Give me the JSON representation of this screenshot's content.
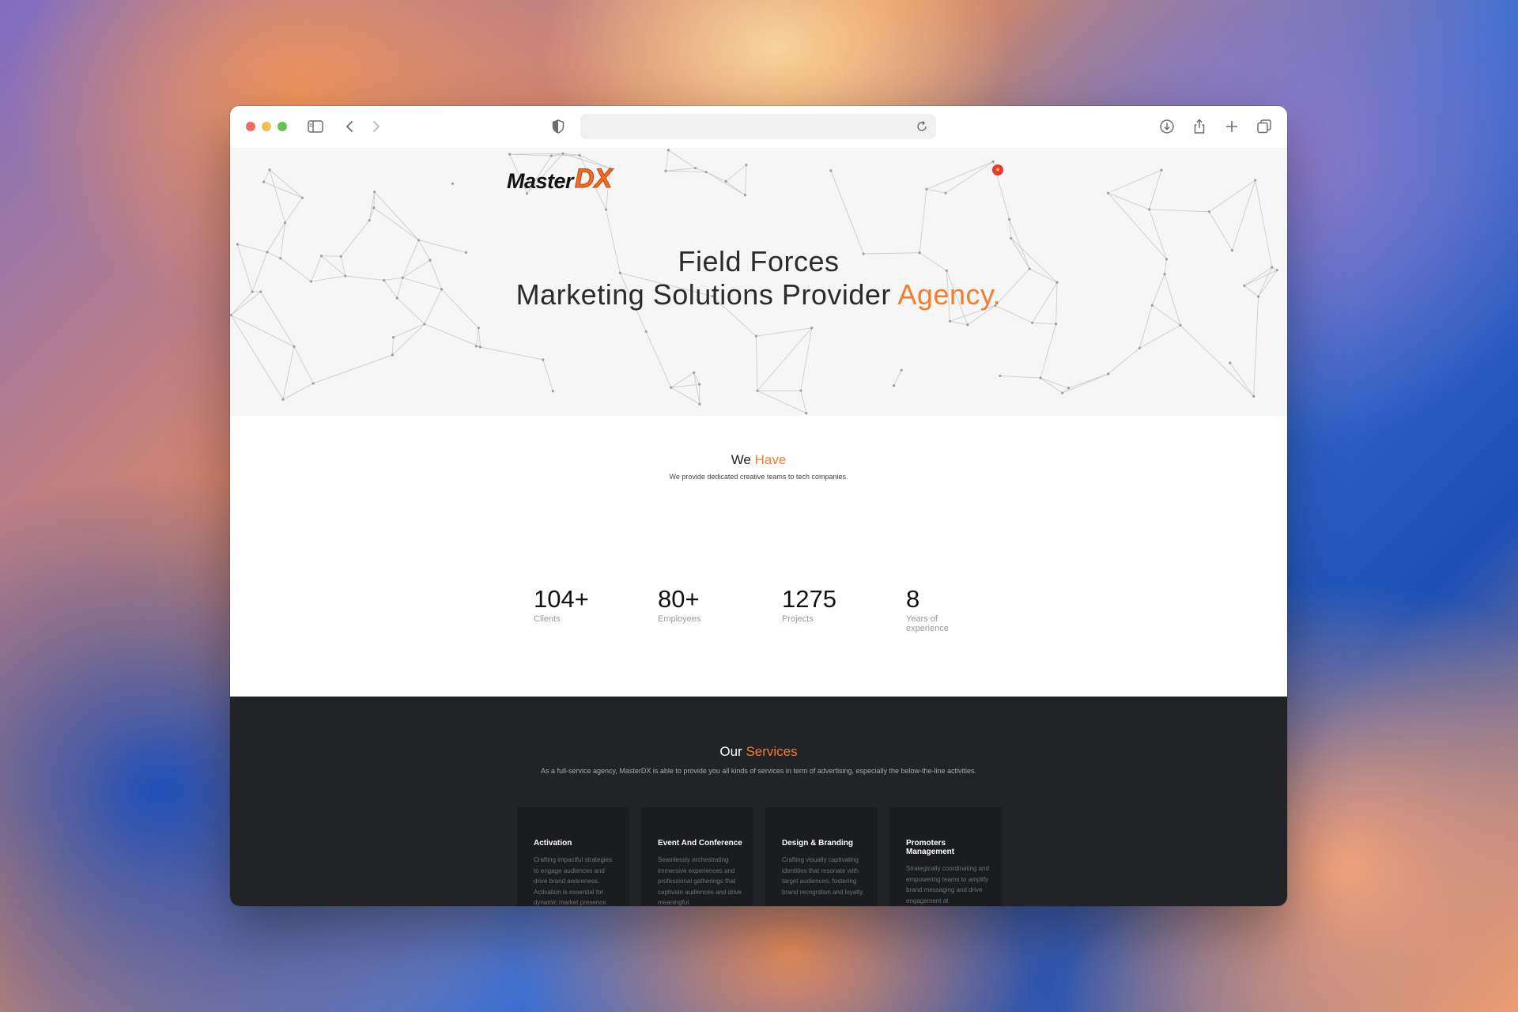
{
  "browser": {
    "url": "",
    "icons": [
      "sidebar-icon",
      "back-icon",
      "forward-icon",
      "privacy-shield-icon",
      "reload-icon",
      "download-icon",
      "share-icon",
      "new-tab-icon",
      "tabs-overview-icon"
    ]
  },
  "colors": {
    "accent": "#f47c2a",
    "dark_section": "#222327",
    "hero_bg": "#f6f6f6"
  },
  "hero": {
    "logo_master": "Master",
    "logo_dx": "DX",
    "title_line1": "Field Forces",
    "title_line2": "Marketing Solutions Provider ",
    "title_accent": "Agency.",
    "badge_icon": "vietnam-flag-icon"
  },
  "have": {
    "title_plain": "We ",
    "title_accent": "Have",
    "subtitle": "We provide dedicated creative teams to tech companies.",
    "stats": [
      {
        "value": "104+",
        "label": "Clients"
      },
      {
        "value": "80+",
        "label": "Employees"
      },
      {
        "value": "1275",
        "label": "Projects"
      },
      {
        "value": "8",
        "label": "Years of experience"
      }
    ]
  },
  "services": {
    "title_plain": "Our ",
    "title_accent": "Services",
    "subtitle": "As a full-service agency, MasterDX is able to provide you all kinds of services in term of advertising, especially the below-the-line activities.",
    "cards": [
      {
        "title": "Activation",
        "desc": "Crafting impactful strategies to engage audiences and drive brand awareness. Activation is essential for dynamic market presence."
      },
      {
        "title": "Event And Conference",
        "desc": "Seamlessly orchestrating immersive experiences and professional gatherings that captivate audiences and drive meaningful"
      },
      {
        "title": "Design & Branding",
        "desc": "Crafting visually captivating identities that resonate with target audiences, fostering brand recognition and loyalty."
      },
      {
        "title": "Promoters Management",
        "desc": "Strategically coordinating and empowering teams to amplify brand messaging and drive engagement at"
      }
    ]
  }
}
